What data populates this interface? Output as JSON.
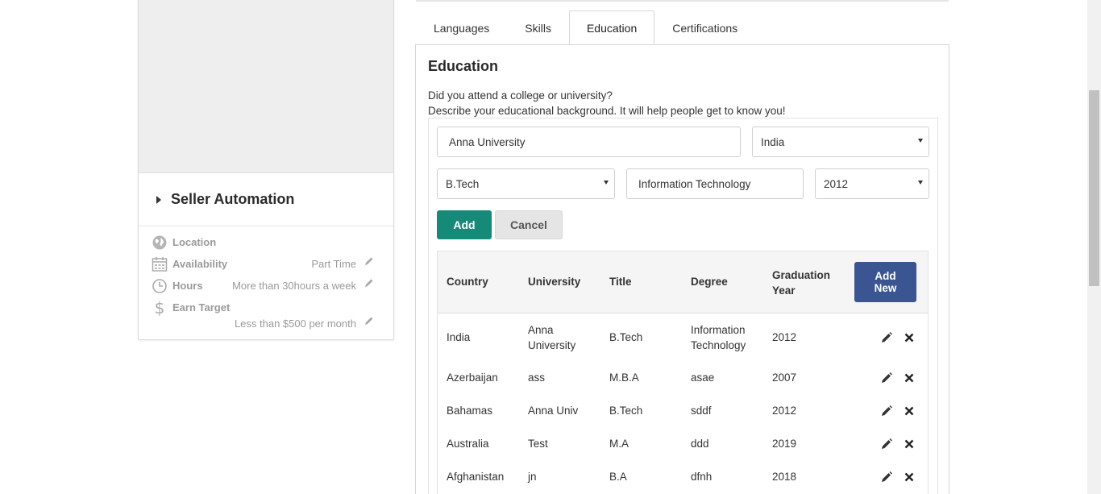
{
  "sidebar": {
    "section_title": "Seller Automation",
    "rows": [
      {
        "icon": "globe-icon",
        "label": "Location",
        "value": ""
      },
      {
        "icon": "calendar-icon",
        "label": "Availability",
        "value": "Part Time"
      },
      {
        "icon": "clock-icon",
        "label": "Hours",
        "value": "More than 30hours a week"
      },
      {
        "icon": "dollar-icon",
        "label": "Earn Target",
        "value": "Less than $500 per month"
      }
    ]
  },
  "tabs": [
    "Languages",
    "Skills",
    "Education",
    "Certifications"
  ],
  "active_tab": "Education",
  "education": {
    "title": "Education",
    "desc_line1": "Did you attend a college or university?",
    "desc_line2": "Describe your educational background. It will help people get to know you!",
    "form": {
      "university": "Anna University",
      "country": "India",
      "title": "B.Tech",
      "degree": "Information Technology",
      "year": "2012",
      "add_label": "Add",
      "cancel_label": "Cancel"
    },
    "table": {
      "headers": {
        "country": "Country",
        "university": "University",
        "title": "Title",
        "degree": "Degree",
        "year_1": "Graduation",
        "year_2": "Year"
      },
      "add_new_1": "Add",
      "add_new_2": "New",
      "rows": [
        {
          "country": "India",
          "university_1": "Anna",
          "university_2": "University",
          "title": "B.Tech",
          "degree_1": "Information",
          "degree_2": "Technology",
          "year": "2012"
        },
        {
          "country": "Azerbaijan",
          "university_1": "ass",
          "university_2": "",
          "title": "M.B.A",
          "degree_1": "asae",
          "degree_2": "",
          "year": "2007"
        },
        {
          "country": "Bahamas",
          "university_1": "Anna Univ",
          "university_2": "",
          "title": "B.Tech",
          "degree_1": "sddf",
          "degree_2": "",
          "year": "2012"
        },
        {
          "country": "Australia",
          "university_1": "Test",
          "university_2": "",
          "title": "M.A",
          "degree_1": "ddd",
          "degree_2": "",
          "year": "2019"
        },
        {
          "country": "Afghanistan",
          "university_1": "jn",
          "university_2": "",
          "title": "B.A",
          "degree_1": "dfnh",
          "degree_2": "",
          "year": "2018"
        }
      ]
    }
  },
  "colors": {
    "add_button": "#168a78",
    "add_new_button": "#3a5591",
    "cancel_button": "#e5e5e5"
  }
}
